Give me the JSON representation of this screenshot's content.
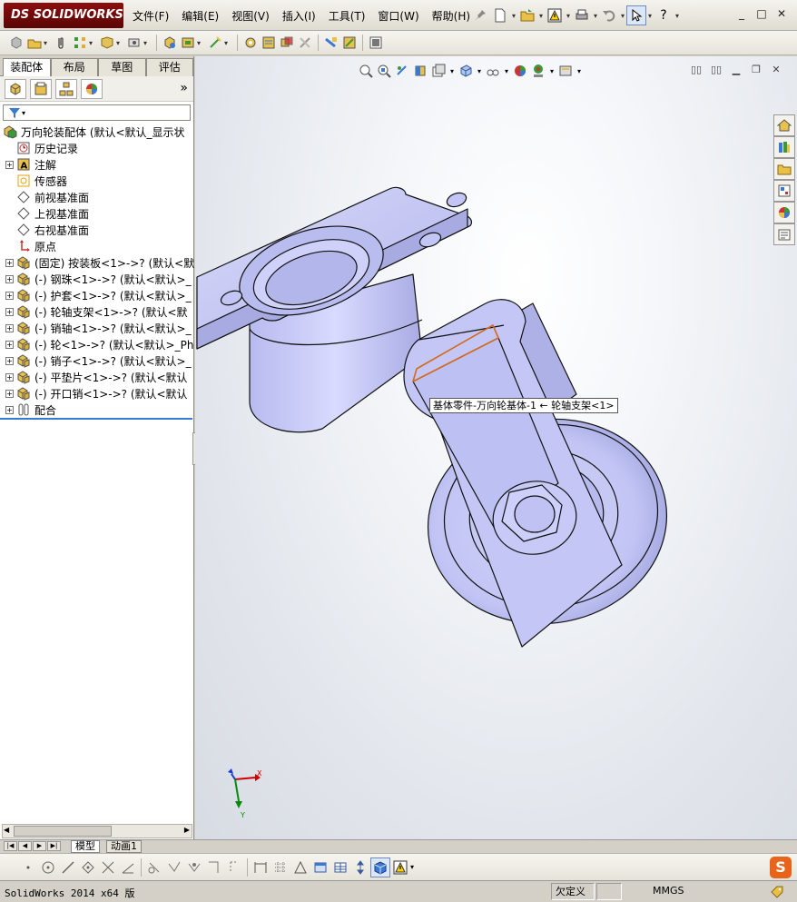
{
  "app": {
    "logo_text": "SOLIDWORKS",
    "logo_mark": "DS"
  },
  "menu": [
    "文件(F)",
    "编辑(E)",
    "视图(V)",
    "插入(I)",
    "工具(T)",
    "窗口(W)",
    "帮助(H)"
  ],
  "window_controls": [
    "_",
    "□",
    "✕"
  ],
  "help_symbol": "?",
  "manager_tabs": [
    {
      "label": "装配体",
      "active": true
    },
    {
      "label": "布局",
      "active": false
    },
    {
      "label": "草图",
      "active": false
    },
    {
      "label": "评估",
      "active": false
    }
  ],
  "more_symbol": "»",
  "tree": {
    "root": "万向轮装配体 (默认<默认_显示状",
    "items": [
      {
        "label": "历史记录",
        "icon": "history-icon",
        "expand": false
      },
      {
        "label": "注解",
        "icon": "annotation-icon",
        "expand": true
      },
      {
        "label": "传感器",
        "icon": "sensor-icon",
        "expand": false
      },
      {
        "label": "前视基准面",
        "icon": "plane-icon",
        "expand": false
      },
      {
        "label": "上视基准面",
        "icon": "plane-icon",
        "expand": false
      },
      {
        "label": "右视基准面",
        "icon": "plane-icon",
        "expand": false
      },
      {
        "label": "原点",
        "icon": "origin-icon",
        "expand": false
      },
      {
        "label": "(固定) 按装板<1>->? (默认<默",
        "icon": "part-icon",
        "expand": true
      },
      {
        "label": "(-) 钢珠<1>->? (默认<默认>_",
        "icon": "part-icon",
        "expand": true
      },
      {
        "label": "(-) 护套<1>->? (默认<默认>_",
        "icon": "part-icon",
        "expand": true
      },
      {
        "label": "(-) 轮轴支架<1>->? (默认<默",
        "icon": "part-icon",
        "expand": true
      },
      {
        "label": "(-) 销轴<1>->? (默认<默认>_",
        "icon": "part-icon",
        "expand": true
      },
      {
        "label": "(-) 轮<1>->? (默认<默认>_Ph",
        "icon": "part-icon",
        "expand": true
      },
      {
        "label": "(-) 销子<1>->? (默认<默认>_",
        "icon": "part-icon",
        "expand": true
      },
      {
        "label": "(-) 平垫片<1>->? (默认<默认",
        "icon": "part-icon",
        "expand": true
      },
      {
        "label": "(-) 开口销<1>->? (默认<默认",
        "icon": "part-icon",
        "expand": true
      },
      {
        "label": "配合",
        "icon": "mate-icon",
        "expand": true
      }
    ]
  },
  "tooltip": "基体零件-万向轮基体-1 ← 轮轴支架<1>",
  "triad": {
    "x": "X",
    "y": "Y"
  },
  "bottom_tabs": [
    "模型",
    "动画1"
  ],
  "nav_arrows": [
    "|◀",
    "◀",
    "▶",
    "▶|"
  ],
  "status": {
    "version": "SolidWorks 2014 x64 版",
    "state": "欠定义",
    "units": "MMGS"
  },
  "colors": {
    "part_fill": "#c6c9f4",
    "part_shade": "#9fa3dc",
    "edge": "#111111",
    "highlight": "#d2691e",
    "menubar": "#ecebe4",
    "logo": "#7a0a0a"
  }
}
